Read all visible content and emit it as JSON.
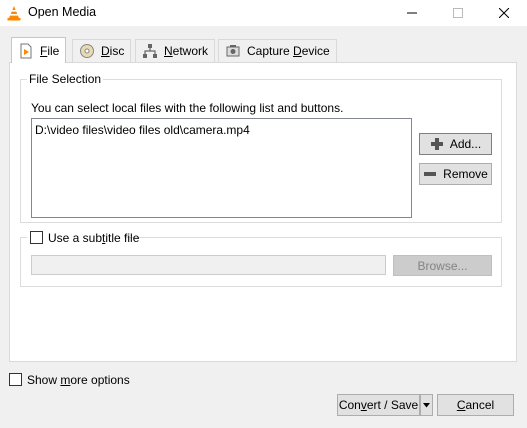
{
  "window": {
    "title": "Open Media",
    "minimize_icon": "minimize-icon",
    "maximize_icon": "maximize-icon",
    "close_icon": "close-icon"
  },
  "tabs": [
    {
      "label": "File",
      "accel": "F",
      "rest": "ile",
      "icon": "file-icon",
      "active": true
    },
    {
      "label": "Disc",
      "accel": "D",
      "rest": "isc",
      "icon": "disc-icon",
      "active": false
    },
    {
      "label": "Network",
      "accel": "N",
      "rest": "etwork",
      "icon": "network-icon",
      "active": false
    },
    {
      "label": "Capture Device",
      "pre": "Capture ",
      "accel": "D",
      "rest": "evice",
      "icon": "capture-device-icon",
      "active": false
    }
  ],
  "file_selection": {
    "title": "File Selection",
    "hint": "You can select local files with the following list and buttons.",
    "files": [
      "D:\\video files\\video files old\\camera.mp4"
    ],
    "add_label": "Add...",
    "remove_label": "Remove"
  },
  "subtitle": {
    "pre": "Use a sub",
    "accel": "t",
    "rest": "itle file",
    "checked": false,
    "path_value": "",
    "browse_label": "Browse..."
  },
  "options": {
    "pre": "Show ",
    "accel": "m",
    "rest": "ore options",
    "checked": false
  },
  "footer": {
    "convert_pre": "Con",
    "convert_accel": "v",
    "convert_rest": "ert / Save",
    "cancel_accel": "C",
    "cancel_rest": "ancel"
  },
  "colors": {
    "accent": "#3d7cc9",
    "vlc_orange": "#ff8800"
  }
}
